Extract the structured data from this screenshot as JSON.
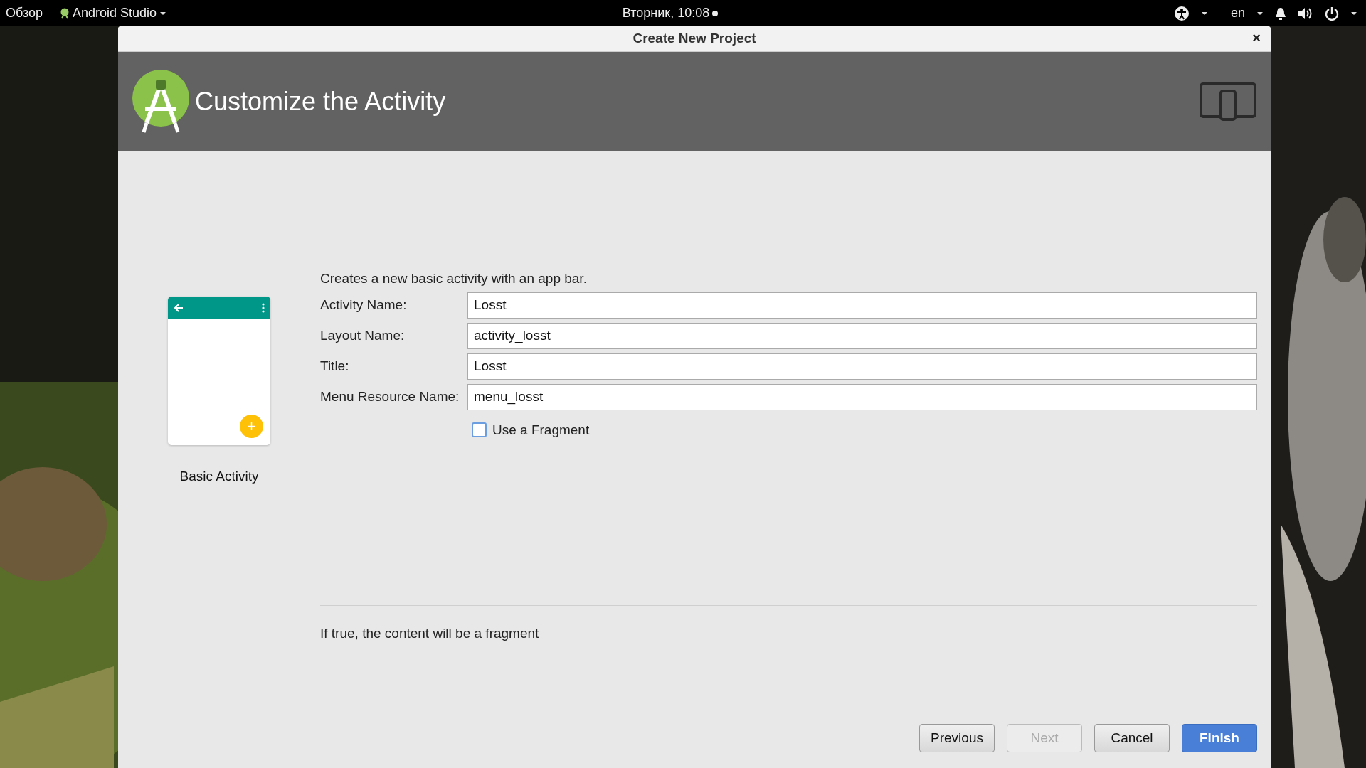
{
  "top_bar": {
    "activities": "Обзор",
    "app_menu": "Android Studio",
    "clock": "Вторник, 10:08",
    "keyboard_layout": "en"
  },
  "dialog": {
    "title": "Create New Project",
    "close": "×",
    "header": {
      "title": "Customize the Activity"
    },
    "template": {
      "name": "Basic Activity"
    },
    "description": "Creates a new basic activity with an app bar.",
    "fields": [
      {
        "label": "Activity Name:",
        "value": "Losst"
      },
      {
        "label": "Layout Name:",
        "value": "activity_losst"
      },
      {
        "label": "Title:",
        "value": "Losst"
      },
      {
        "label": "Menu Resource Name:",
        "value": "menu_losst"
      }
    ],
    "fragment_option": {
      "label": "Use a Fragment",
      "checked": false
    },
    "help_text": "If true, the content will be a fragment",
    "buttons": [
      {
        "label": "Previous",
        "kind": "default",
        "disabled": false
      },
      {
        "label": "Next",
        "kind": "default",
        "disabled": true
      },
      {
        "label": "Cancel",
        "kind": "default",
        "disabled": false
      },
      {
        "label": "Finish",
        "kind": "primary",
        "disabled": false
      }
    ]
  }
}
